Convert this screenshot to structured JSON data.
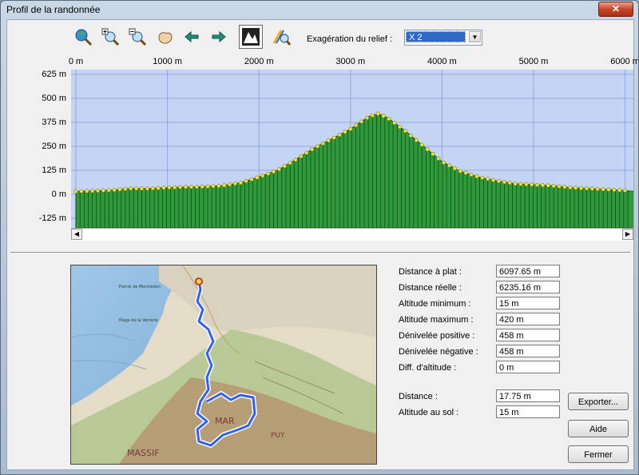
{
  "window": {
    "title": "Profil de la randonnée",
    "close_label": "✕"
  },
  "toolbar": {
    "buttons": [
      "zoom-extent-icon",
      "zoom-in-icon",
      "zoom-out-icon",
      "pan-hand-icon",
      "back-arrow-icon",
      "forward-arrow-icon",
      "relief-profile-icon",
      "measure-icon"
    ],
    "relief_label": "Exagération du relief :",
    "relief_value": "X 2"
  },
  "chart_data": {
    "type": "area",
    "xlabel": "",
    "ylabel": "",
    "xlim": [
      0,
      6097.65
    ],
    "ylim": [
      -175,
      650
    ],
    "x_ticks": [
      "0 m",
      "1000 m",
      "2000 m",
      "3000 m",
      "4000 m",
      "5000 m",
      "6000 m"
    ],
    "y_ticks": [
      "625 m",
      "500 m",
      "375 m",
      "250 m",
      "125 m",
      "0 m",
      "-125 m"
    ],
    "grid": true,
    "series": [
      {
        "x": [
          0,
          200,
          400,
          600,
          800,
          1000,
          1200,
          1400,
          1600,
          1800,
          2000,
          2200,
          2400,
          2600,
          2800,
          3000,
          3200,
          3300,
          3400,
          3600,
          3800,
          4000,
          4200,
          4400,
          4600,
          4800,
          5000,
          5200,
          5400,
          5600,
          5800,
          6000,
          6097
        ],
        "values": [
          15,
          18,
          22,
          30,
          30,
          35,
          38,
          40,
          45,
          60,
          90,
          125,
          180,
          240,
          290,
          340,
          405,
          420,
          400,
          330,
          250,
          170,
          120,
          90,
          70,
          55,
          50,
          45,
          35,
          30,
          25,
          20,
          15
        ]
      }
    ]
  },
  "stats": [
    {
      "label": "Distance à plat :",
      "value": "6097.65 m"
    },
    {
      "label": "Distance réelle :",
      "value": "6235.16 m"
    },
    {
      "label": "Altitude minimum :",
      "value": "15 m"
    },
    {
      "label": "Altitude maximum :",
      "value": "420 m"
    },
    {
      "label": "Dénivelée positive :",
      "value": "458 m"
    },
    {
      "label": "Dénivelée négative :",
      "value": "458 m"
    },
    {
      "label": "Diff. d'altitude :",
      "value": "0 m"
    }
  ],
  "cursor": [
    {
      "label": "Distance :",
      "value": "17.75 m"
    },
    {
      "label": "Altitude au sol :",
      "value": "15 m"
    }
  ],
  "buttons": {
    "export": "Exporter...",
    "help": "Aide",
    "close": "Fermer"
  },
  "map": {
    "labels": [
      "Pointe de Montredon",
      "Plage de la Verrerie",
      "MASSIF",
      "MAR",
      "PUY"
    ]
  },
  "colors": {
    "profile_fill": "#2f9a3a",
    "chart_bg": "#c4d4f4",
    "track": "#2f5fff",
    "marker": "#f2e33a"
  }
}
